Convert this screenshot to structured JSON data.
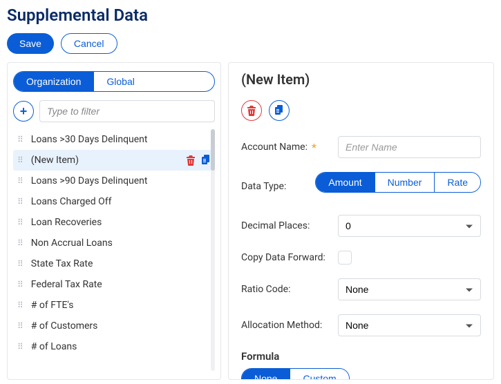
{
  "header": {
    "title": "Supplemental Data",
    "save_label": "Save",
    "cancel_label": "Cancel"
  },
  "sidebar": {
    "scope_tabs": {
      "org": "Organization",
      "global": "Global",
      "active": "org"
    },
    "filter_placeholder": "Type to filter",
    "items": [
      {
        "label": "Loans >30 Days Delinquent",
        "selected": false
      },
      {
        "label": "(New Item)",
        "selected": true
      },
      {
        "label": "Loans >90 Days Delinquent",
        "selected": false
      },
      {
        "label": "Loans Charged Off",
        "selected": false
      },
      {
        "label": "Loan Recoveries",
        "selected": false
      },
      {
        "label": "Non Accrual Loans",
        "selected": false
      },
      {
        "label": "State Tax Rate",
        "selected": false
      },
      {
        "label": "Federal Tax Rate",
        "selected": false
      },
      {
        "label": "# of FTE's",
        "selected": false
      },
      {
        "label": "# of Customers",
        "selected": false
      },
      {
        "label": "# of Loans",
        "selected": false
      }
    ]
  },
  "detail": {
    "title": "(New Item)",
    "labels": {
      "account_name": "Account Name:",
      "data_type": "Data Type:",
      "decimal_places": "Decimal Places:",
      "copy_forward": "Copy Data Forward:",
      "ratio_code": "Ratio Code:",
      "allocation": "Allocation Method:",
      "formula": "Formula"
    },
    "account_name_placeholder": "Enter Name",
    "account_name_value": "",
    "data_type_options": {
      "amount": "Amount",
      "number": "Number",
      "rate": "Rate",
      "active": "amount"
    },
    "decimal_places_value": "0",
    "copy_forward_checked": false,
    "ratio_code_value": "None",
    "allocation_value": "None",
    "formula_options": {
      "none": "None",
      "custom": "Custom",
      "active": "none"
    }
  },
  "icons": {
    "plus": "plus",
    "trash": "trash",
    "duplicate": "duplicate"
  }
}
